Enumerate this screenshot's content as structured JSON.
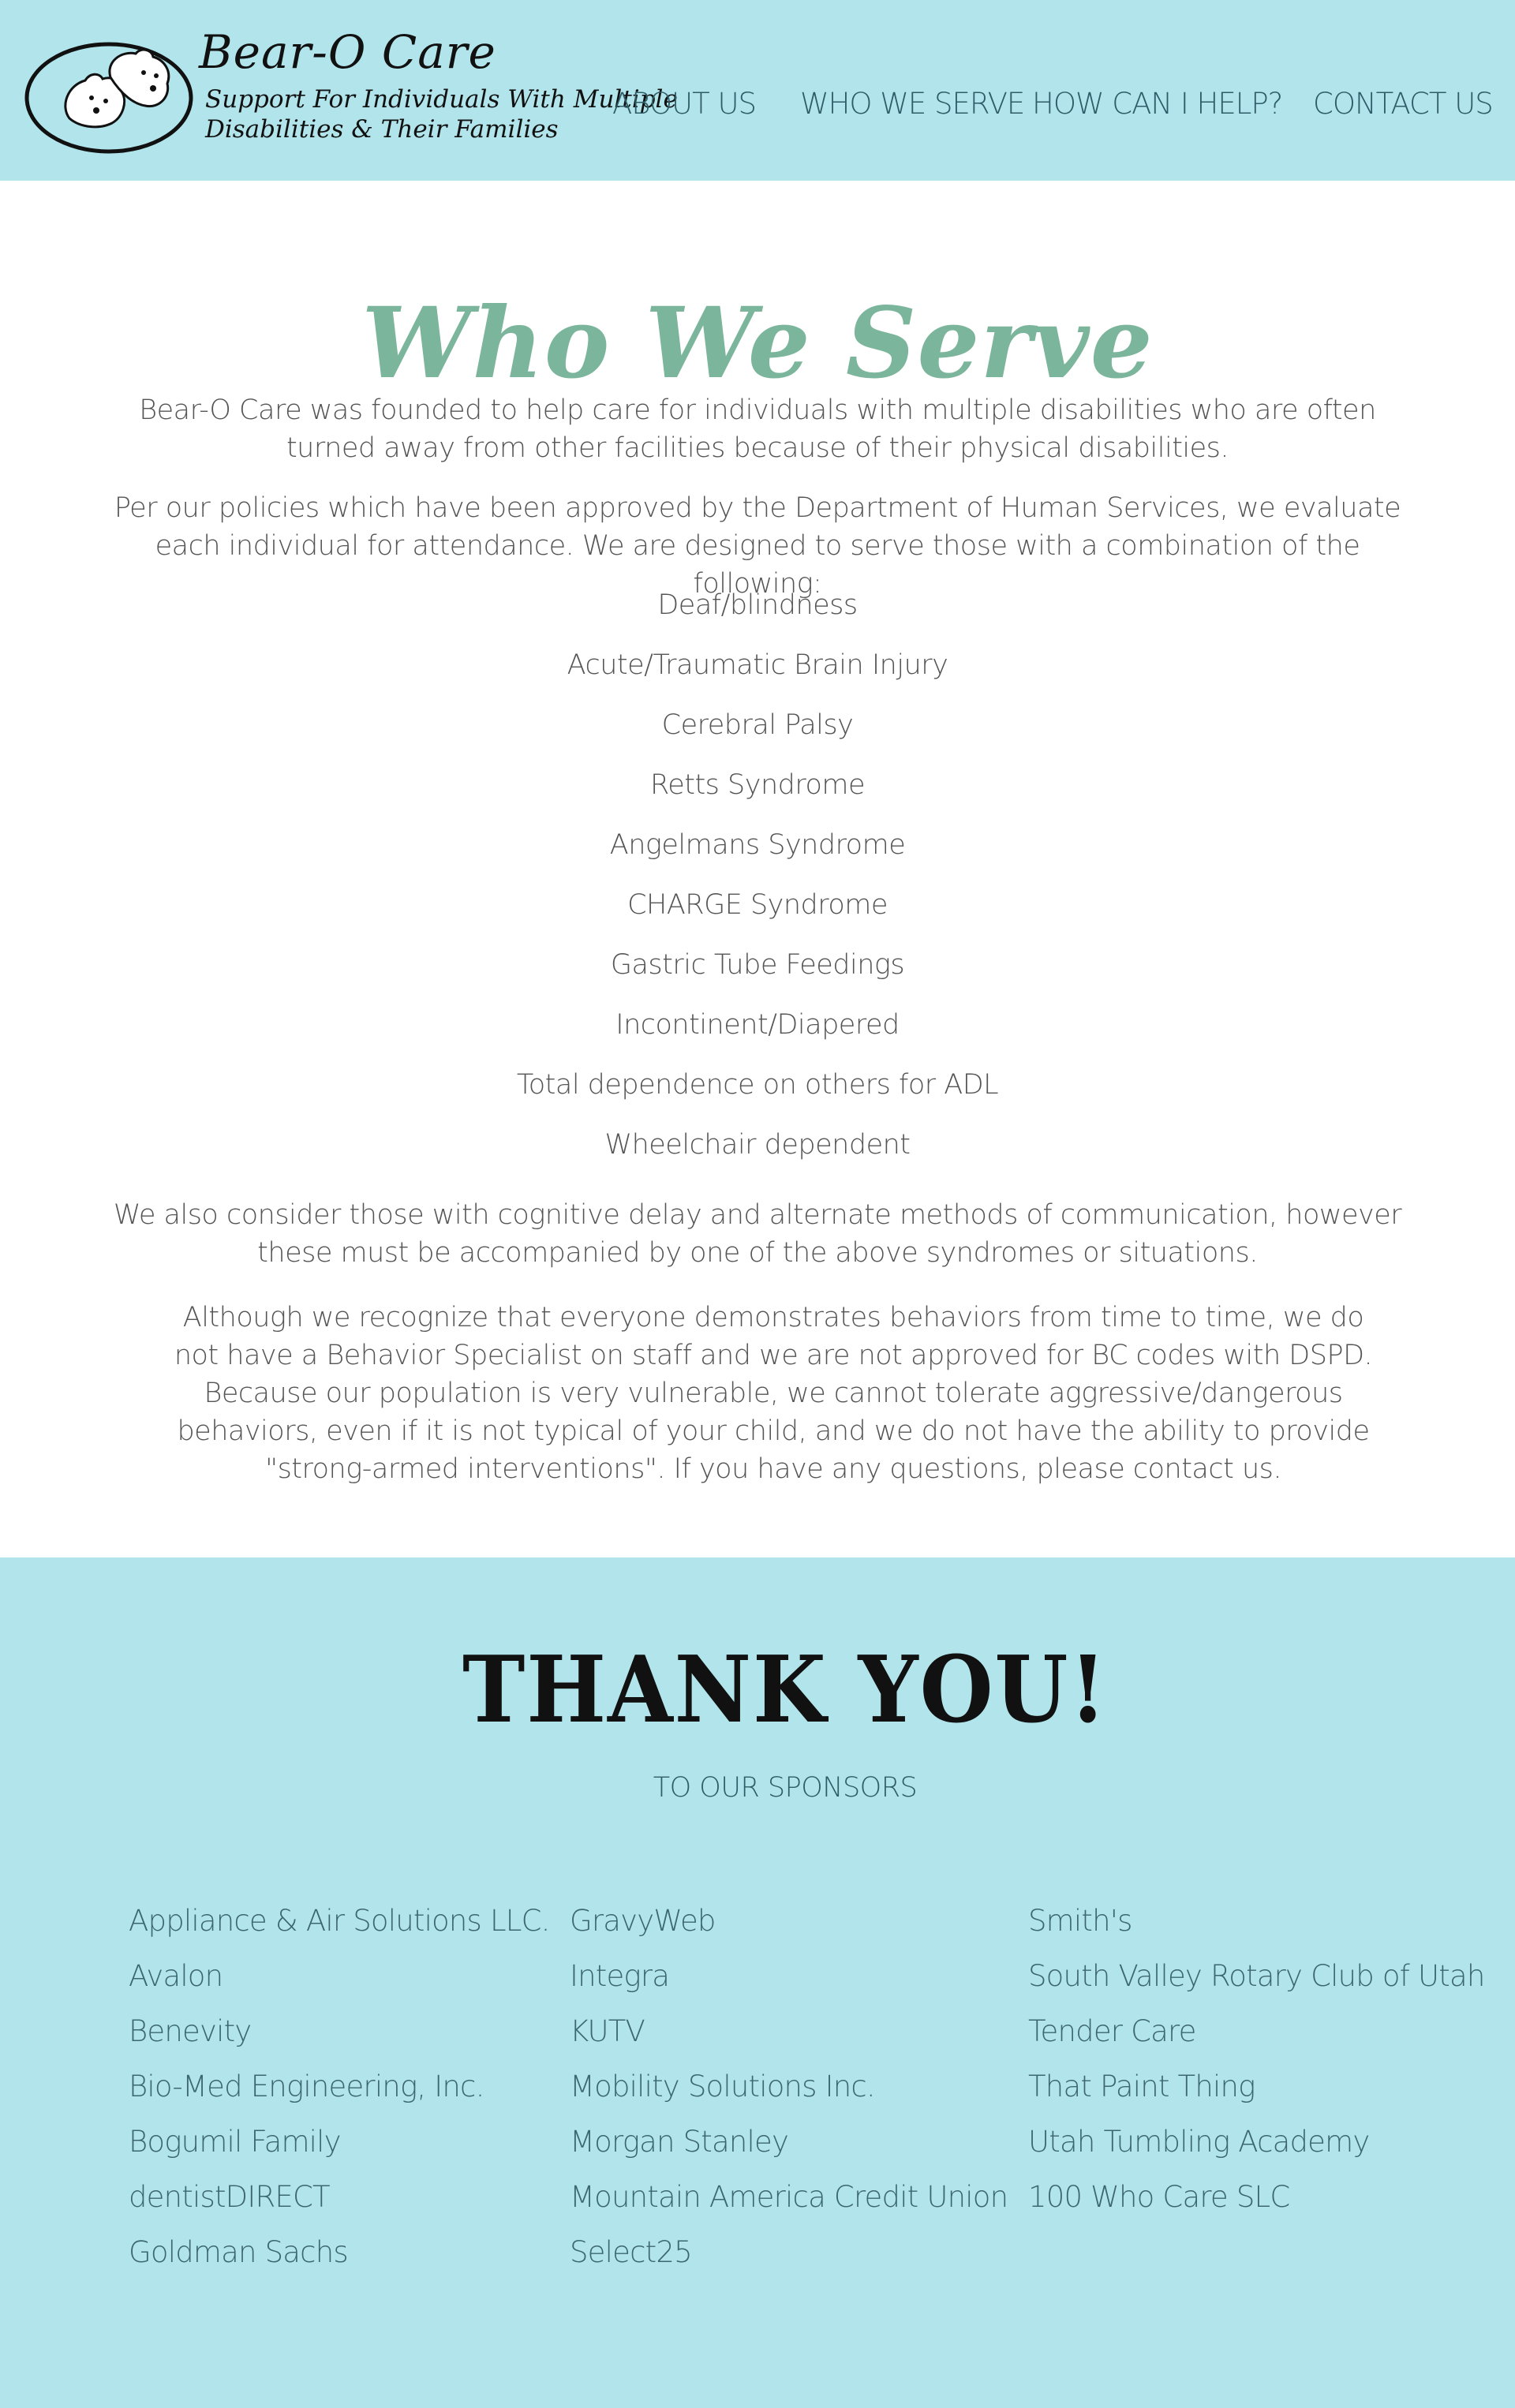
{
  "header": {
    "logo": {
      "name": "Bear-O Care",
      "tagline_line1": "Support For Individuals With Multiple",
      "tagline_line2": "Disabilities & Their Families",
      "icon": "bear-icon"
    },
    "nav": [
      {
        "label": "ABOUT US"
      },
      {
        "label": "WHO WE SERVE"
      },
      {
        "label": "HOW CAN I HELP?"
      },
      {
        "label": "CONTACT US"
      }
    ]
  },
  "main": {
    "title": "Who We Serve",
    "intro": "Bear-O Care was founded to help care for individuals with multiple disabilities who are often turned away from other facilities because of their physical disabilities.",
    "policy": "Per our policies which have been approved by the Department of Human Services, we evaluate each individual for attendance. We are designed to serve those with a combination of the following:",
    "conditions": [
      "Deaf/blindness",
      "Acute/Traumatic Brain Injury",
      "Cerebral Palsy",
      "Retts Syndrome",
      "Angelmans Syndrome",
      "CHARGE Syndrome",
      "Gastric Tube Feedings",
      "Incontinent/Diapered",
      "Total dependence on others for ADL",
      "Wheelchair dependent"
    ],
    "cognitive_note": "We also consider those with cognitive delay and alternate methods of communication, however these must be accompanied by one of the above syndromes or situations.",
    "behavior_note": "Although we recognize that everyone demonstrates behaviors from time to time, we do not have a Behavior Specialist on staff and we are not approved for BC codes with DSPD. Because our population is very vulnerable, we cannot tolerate aggressive/dangerous behaviors, even if it is not typical of your child, and we do not have the ability to provide \"strong-armed interventions\". If you have any questions, please contact us."
  },
  "footer": {
    "title": "THANK YOU!",
    "subtitle": "TO OUR SPONSORS",
    "sponsors": {
      "col1": [
        "Appliance & Air Solutions LLC.",
        "Avalon",
        "Benevity",
        "Bio-Med Engineering, Inc.",
        "Bogumil Family",
        "dentistDIRECT",
        "Goldman Sachs"
      ],
      "col2": [
        "GravyWeb",
        "Integra",
        "KUTV",
        "Mobility Solutions Inc.",
        "Morgan Stanley",
        "Mountain America Credit Union",
        "Select25"
      ],
      "col3": [
        "Smith's",
        "South Valley Rotary Club of Utah",
        "Tender Care",
        "That Paint Thing",
        "Utah Tumbling Academy",
        "100 Who Care SLC"
      ]
    }
  },
  "colors": {
    "header_bg": "#b2e5eb",
    "title_green": "#7bb59b",
    "body_text": "#555555",
    "nav_text": "#2f5c66"
  }
}
